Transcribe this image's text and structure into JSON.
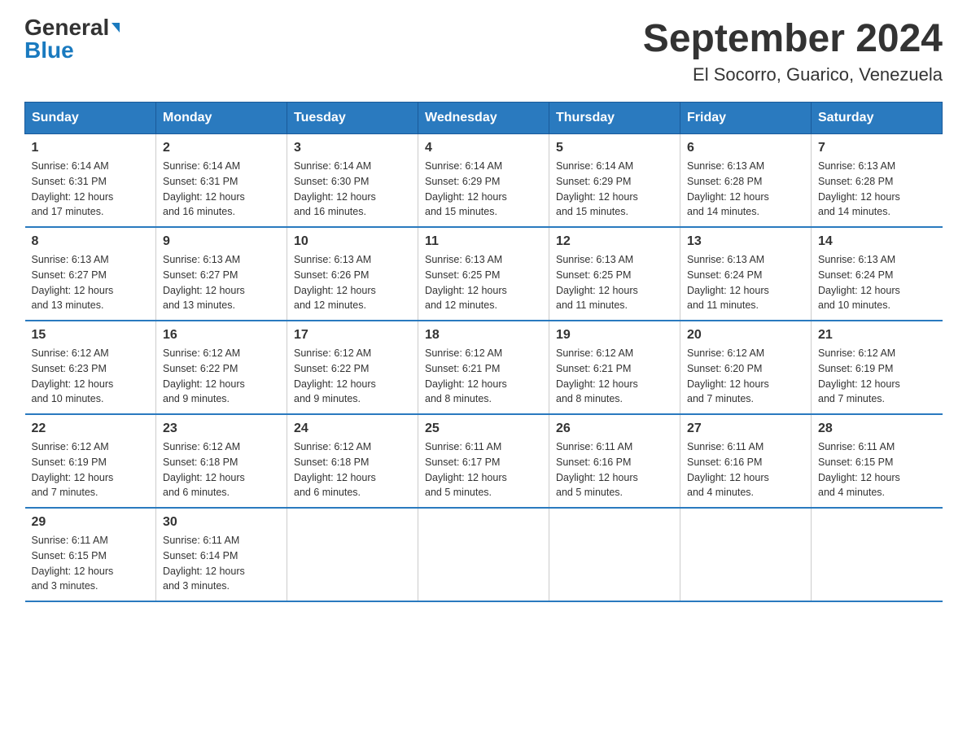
{
  "header": {
    "logo_general": "General",
    "logo_blue": "Blue",
    "title": "September 2024",
    "subtitle": "El Socorro, Guarico, Venezuela"
  },
  "days_of_week": [
    "Sunday",
    "Monday",
    "Tuesday",
    "Wednesday",
    "Thursday",
    "Friday",
    "Saturday"
  ],
  "weeks": [
    [
      {
        "day": "1",
        "sunrise": "6:14 AM",
        "sunset": "6:31 PM",
        "daylight": "12 hours and 17 minutes."
      },
      {
        "day": "2",
        "sunrise": "6:14 AM",
        "sunset": "6:31 PM",
        "daylight": "12 hours and 16 minutes."
      },
      {
        "day": "3",
        "sunrise": "6:14 AM",
        "sunset": "6:30 PM",
        "daylight": "12 hours and 16 minutes."
      },
      {
        "day": "4",
        "sunrise": "6:14 AM",
        "sunset": "6:29 PM",
        "daylight": "12 hours and 15 minutes."
      },
      {
        "day": "5",
        "sunrise": "6:14 AM",
        "sunset": "6:29 PM",
        "daylight": "12 hours and 15 minutes."
      },
      {
        "day": "6",
        "sunrise": "6:13 AM",
        "sunset": "6:28 PM",
        "daylight": "12 hours and 14 minutes."
      },
      {
        "day": "7",
        "sunrise": "6:13 AM",
        "sunset": "6:28 PM",
        "daylight": "12 hours and 14 minutes."
      }
    ],
    [
      {
        "day": "8",
        "sunrise": "6:13 AM",
        "sunset": "6:27 PM",
        "daylight": "12 hours and 13 minutes."
      },
      {
        "day": "9",
        "sunrise": "6:13 AM",
        "sunset": "6:27 PM",
        "daylight": "12 hours and 13 minutes."
      },
      {
        "day": "10",
        "sunrise": "6:13 AM",
        "sunset": "6:26 PM",
        "daylight": "12 hours and 12 minutes."
      },
      {
        "day": "11",
        "sunrise": "6:13 AM",
        "sunset": "6:25 PM",
        "daylight": "12 hours and 12 minutes."
      },
      {
        "day": "12",
        "sunrise": "6:13 AM",
        "sunset": "6:25 PM",
        "daylight": "12 hours and 11 minutes."
      },
      {
        "day": "13",
        "sunrise": "6:13 AM",
        "sunset": "6:24 PM",
        "daylight": "12 hours and 11 minutes."
      },
      {
        "day": "14",
        "sunrise": "6:13 AM",
        "sunset": "6:24 PM",
        "daylight": "12 hours and 10 minutes."
      }
    ],
    [
      {
        "day": "15",
        "sunrise": "6:12 AM",
        "sunset": "6:23 PM",
        "daylight": "12 hours and 10 minutes."
      },
      {
        "day": "16",
        "sunrise": "6:12 AM",
        "sunset": "6:22 PM",
        "daylight": "12 hours and 9 minutes."
      },
      {
        "day": "17",
        "sunrise": "6:12 AM",
        "sunset": "6:22 PM",
        "daylight": "12 hours and 9 minutes."
      },
      {
        "day": "18",
        "sunrise": "6:12 AM",
        "sunset": "6:21 PM",
        "daylight": "12 hours and 8 minutes."
      },
      {
        "day": "19",
        "sunrise": "6:12 AM",
        "sunset": "6:21 PM",
        "daylight": "12 hours and 8 minutes."
      },
      {
        "day": "20",
        "sunrise": "6:12 AM",
        "sunset": "6:20 PM",
        "daylight": "12 hours and 7 minutes."
      },
      {
        "day": "21",
        "sunrise": "6:12 AM",
        "sunset": "6:19 PM",
        "daylight": "12 hours and 7 minutes."
      }
    ],
    [
      {
        "day": "22",
        "sunrise": "6:12 AM",
        "sunset": "6:19 PM",
        "daylight": "12 hours and 7 minutes."
      },
      {
        "day": "23",
        "sunrise": "6:12 AM",
        "sunset": "6:18 PM",
        "daylight": "12 hours and 6 minutes."
      },
      {
        "day": "24",
        "sunrise": "6:12 AM",
        "sunset": "6:18 PM",
        "daylight": "12 hours and 6 minutes."
      },
      {
        "day": "25",
        "sunrise": "6:11 AM",
        "sunset": "6:17 PM",
        "daylight": "12 hours and 5 minutes."
      },
      {
        "day": "26",
        "sunrise": "6:11 AM",
        "sunset": "6:16 PM",
        "daylight": "12 hours and 5 minutes."
      },
      {
        "day": "27",
        "sunrise": "6:11 AM",
        "sunset": "6:16 PM",
        "daylight": "12 hours and 4 minutes."
      },
      {
        "day": "28",
        "sunrise": "6:11 AM",
        "sunset": "6:15 PM",
        "daylight": "12 hours and 4 minutes."
      }
    ],
    [
      {
        "day": "29",
        "sunrise": "6:11 AM",
        "sunset": "6:15 PM",
        "daylight": "12 hours and 3 minutes."
      },
      {
        "day": "30",
        "sunrise": "6:11 AM",
        "sunset": "6:14 PM",
        "daylight": "12 hours and 3 minutes."
      },
      null,
      null,
      null,
      null,
      null
    ]
  ],
  "labels": {
    "sunrise": "Sunrise:",
    "sunset": "Sunset:",
    "daylight": "Daylight:"
  }
}
